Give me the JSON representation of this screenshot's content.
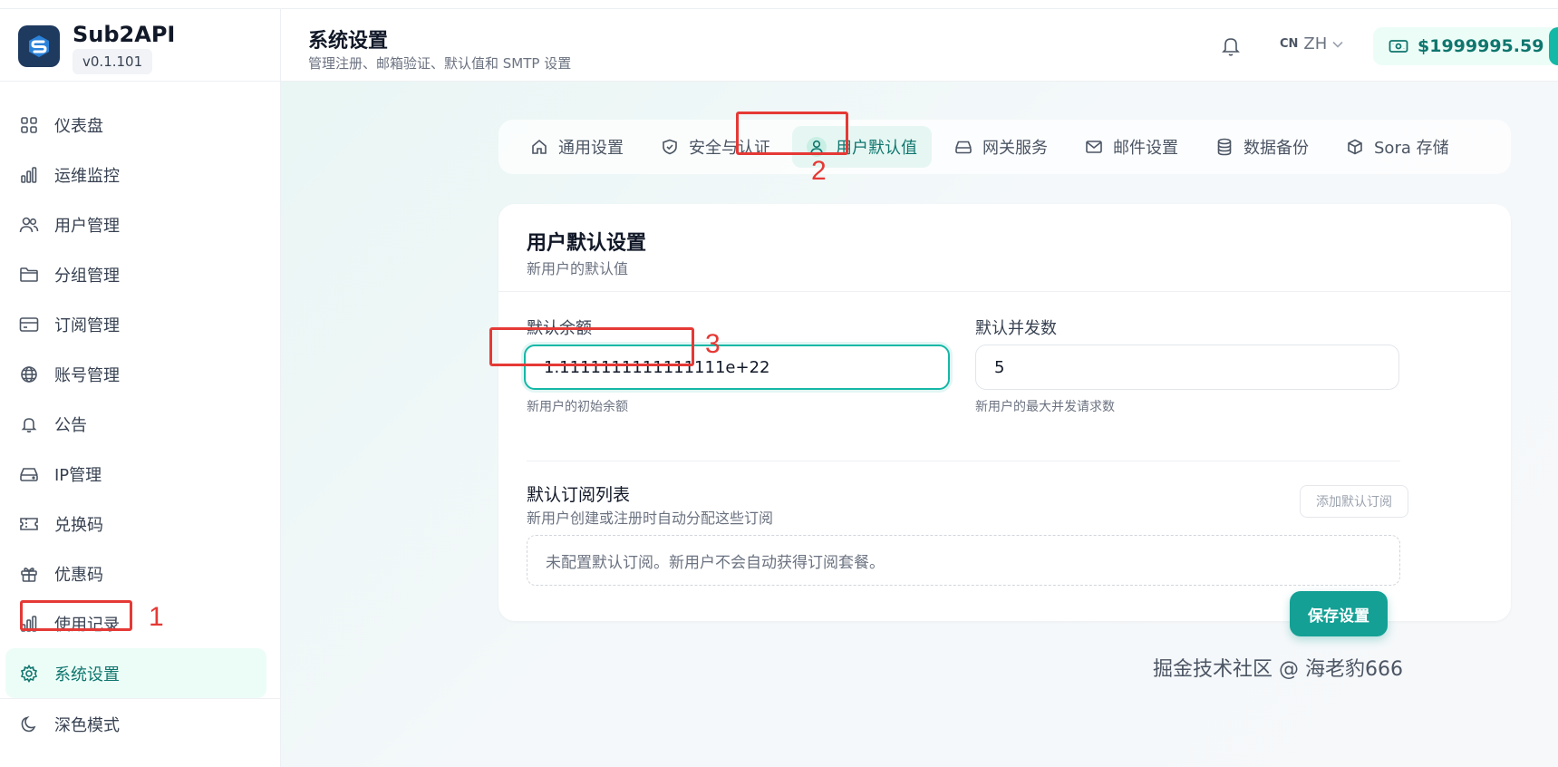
{
  "brand": {
    "name": "Sub2API",
    "version": "v0.1.101"
  },
  "sidebar": {
    "items": [
      {
        "label": "仪表盘",
        "icon": "grid-icon"
      },
      {
        "label": "运维监控",
        "icon": "bar-chart-icon"
      },
      {
        "label": "用户管理",
        "icon": "users-icon"
      },
      {
        "label": "分组管理",
        "icon": "folder-icon"
      },
      {
        "label": "订阅管理",
        "icon": "credit-card-icon"
      },
      {
        "label": "账号管理",
        "icon": "globe-icon"
      },
      {
        "label": "公告",
        "icon": "bell-icon"
      },
      {
        "label": "IP管理",
        "icon": "server-icon"
      },
      {
        "label": "兑换码",
        "icon": "ticket-icon"
      },
      {
        "label": "优惠码",
        "icon": "gift-icon"
      },
      {
        "label": "使用记录",
        "icon": "bar-chart-icon"
      },
      {
        "label": "系统设置",
        "icon": "gear-icon",
        "active": true
      }
    ],
    "dark_mode": {
      "label": "深色模式",
      "icon": "moon-icon"
    }
  },
  "header": {
    "title": "系统设置",
    "subtitle": "管理注册、邮箱验证、默认值和 SMTP 设置",
    "lang_flag": "CN",
    "lang": "ZH",
    "balance": "$1999995.59"
  },
  "tabs": [
    {
      "label": "通用设置",
      "icon": "home-icon"
    },
    {
      "label": "安全与认证",
      "icon": "shield-icon"
    },
    {
      "label": "用户默认值",
      "icon": "user-icon",
      "active": true
    },
    {
      "label": "网关服务",
      "icon": "server-icon"
    },
    {
      "label": "邮件设置",
      "icon": "mail-icon"
    },
    {
      "label": "数据备份",
      "icon": "database-icon"
    },
    {
      "label": "Sora 存储",
      "icon": "cube-icon"
    }
  ],
  "card": {
    "title": "用户默认设置",
    "subtitle": "新用户的默认值",
    "default_balance": {
      "label": "默认余额",
      "value": "1.1111111111111111e+22",
      "hint": "新用户的初始余额"
    },
    "default_concurrency": {
      "label": "默认并发数",
      "value": "5",
      "hint": "新用户的最大并发请求数"
    },
    "subscriptions": {
      "title": "默认订阅列表",
      "description": "新用户创建或注册时自动分配这些订阅",
      "add_button": "添加默认订阅",
      "empty_text": "未配置默认订阅。新用户不会自动获得订阅套餐。"
    }
  },
  "save_button": "保存设置",
  "watermark": "掘金技术社区 @ 海老豹666",
  "annotations": {
    "n1": "1",
    "n2": "2",
    "n3": "3"
  },
  "colors": {
    "accent": "#14a095",
    "annotation": "#e53935",
    "active_bg": "#ecfdf7"
  }
}
